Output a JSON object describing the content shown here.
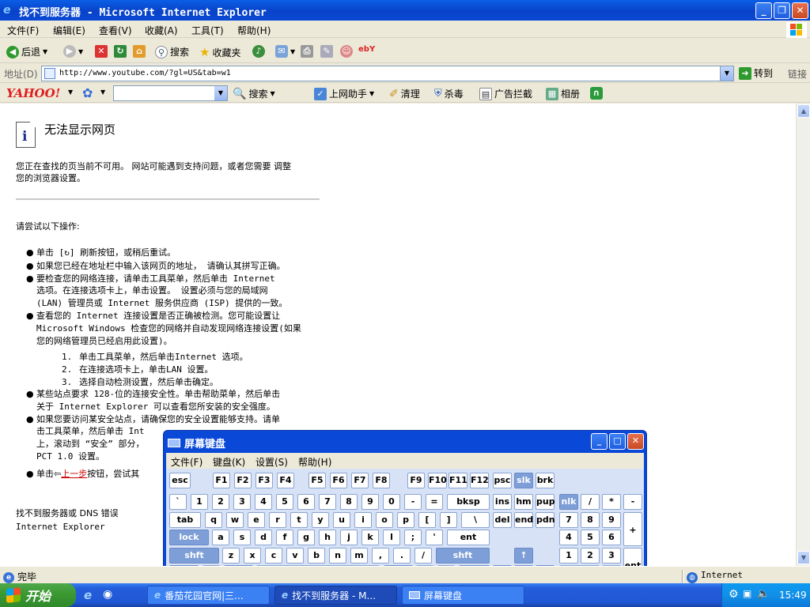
{
  "window": {
    "title": "找不到服务器 - Microsoft Internet Explorer"
  },
  "menu": [
    "文件(F)",
    "编辑(E)",
    "查看(V)",
    "收藏(A)",
    "工具(T)",
    "帮助(H)"
  ],
  "toolbar": {
    "back": "后退",
    "search": "搜索",
    "favorites": "收藏夹"
  },
  "address": {
    "label": "地址(D)",
    "url": "http://www.youtube.com/?gl=US&tab=w1",
    "go": "转到",
    "links": "链接"
  },
  "yahoo": {
    "logo": "YAHOO!",
    "search": "搜索",
    "helper": "上网助手",
    "clean": "清理",
    "antivirus": "杀毒",
    "adblock": "广告拦截",
    "album": "相册"
  },
  "page": {
    "heading": "无法显示网页",
    "intro1": "您正在查找的页当前不可用。 网站可能遇到支持问题，或者您需要 调整",
    "intro2": "您的浏览器设置。",
    "try": "请尝试以下操作:",
    "tips": [
      "单击 [↻] 刷新按钮，或稍后重试。",
      "如果您已经在地址栏中输入该网页的地址， 请确认其拼写正确。",
      "要检查您的网络连接，请单击工具菜单，然后单击 Internet",
      "选项。在连接选项卡上，单击设置。 设置必须与您的局域网",
      "(LAN) 管理员或 Internet 服务供应商 (ISP) 提供的一致。",
      "查看您的 Internet 连接设置是否正确被检测。您可能设置让",
      "Microsoft Windows 检查您的网络并自动发现网络连接设置(如果",
      "您的网络管理员已经启用此设置)。"
    ],
    "sub": [
      {
        "n": "1.",
        "text": "单击工具菜单，然后单击Internet 选项。"
      },
      {
        "n": "2.",
        "text": "在连接选项卡上，单击LAN 设置。"
      },
      {
        "n": "3.",
        "text": "选择自动检测设置，然后单击确定。"
      }
    ],
    "tips2": [
      "某些站点要求 128-位的连接安全性。单击帮助菜单，然后单击",
      "关于 Internet Explorer 可以查看您所安装的安全强度。",
      "如果您要访问某安全站点，请确保您的安全设置能够支持。请单",
      "击工具菜单，然后单击 Int",
      "上，滚动到 “安全” 部分，",
      "PCT 1.0 设置。"
    ],
    "last_pre": "单击",
    "last_link": "上一步",
    "last_post": "按钮，尝试其",
    "footer1": "找不到服务器或 DNS 错误",
    "footer2": "Internet Explorer"
  },
  "osk": {
    "title": "屏幕键盘",
    "menu": [
      "文件(F)",
      "键盘(K)",
      "设置(S)",
      "帮助(H)"
    ]
  },
  "status": {
    "text": "完毕",
    "zone": "Internet"
  },
  "taskbar": {
    "start": "开始",
    "tasks": [
      "番茄花园官网|三...",
      "找不到服务器 - M...",
      "屏幕键盘"
    ],
    "clock": "15:49"
  }
}
